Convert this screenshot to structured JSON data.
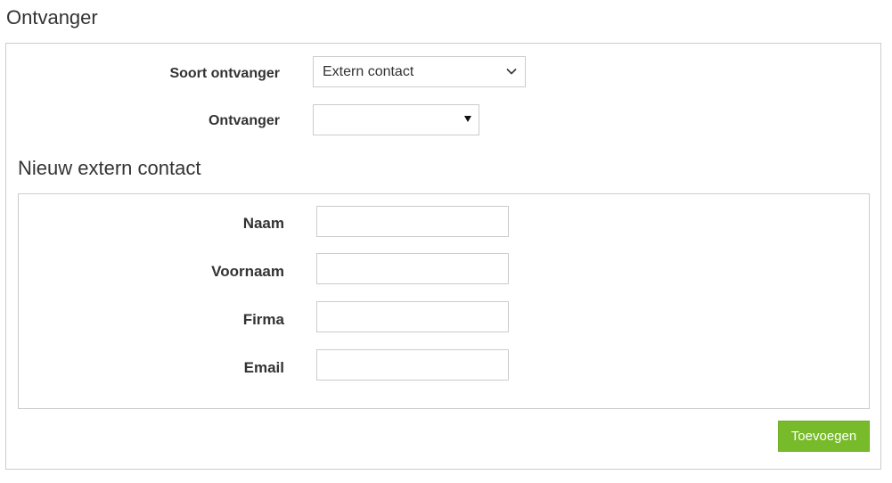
{
  "page": {
    "title": "Ontvanger"
  },
  "recipient": {
    "type_label": "Soort ontvanger",
    "type_value": "Extern contact",
    "recipient_label": "Ontvanger",
    "recipient_value": ""
  },
  "new_contact": {
    "title": "Nieuw extern contact",
    "fields": [
      {
        "label": "Naam",
        "value": ""
      },
      {
        "label": "Voornaam",
        "value": ""
      },
      {
        "label": "Firma",
        "value": ""
      },
      {
        "label": "Email",
        "value": ""
      }
    ],
    "add_button_label": "Toevoegen"
  },
  "icons": {
    "type_select": "chevron-down-icon",
    "recipient_select": "caret-down-icon"
  },
  "colors": {
    "accent": "#77bb2a",
    "border": "#cccccc",
    "text": "#333333"
  }
}
